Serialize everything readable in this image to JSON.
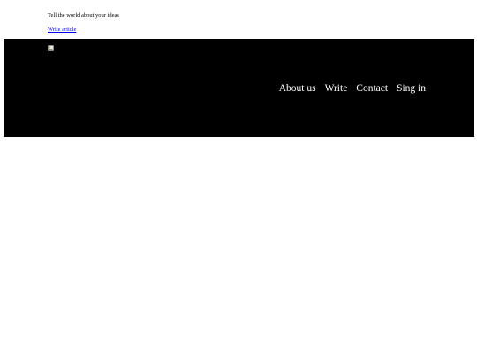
{
  "header": {
    "tagline": "Tell the world about your ideas",
    "write_link": "Write article"
  },
  "nav": {
    "background": "#000000",
    "logo_icon": "broken-image-icon",
    "items": [
      {
        "label": "About us"
      },
      {
        "label": "Write"
      },
      {
        "label": "Contact"
      },
      {
        "label": "Sing in"
      }
    ]
  }
}
